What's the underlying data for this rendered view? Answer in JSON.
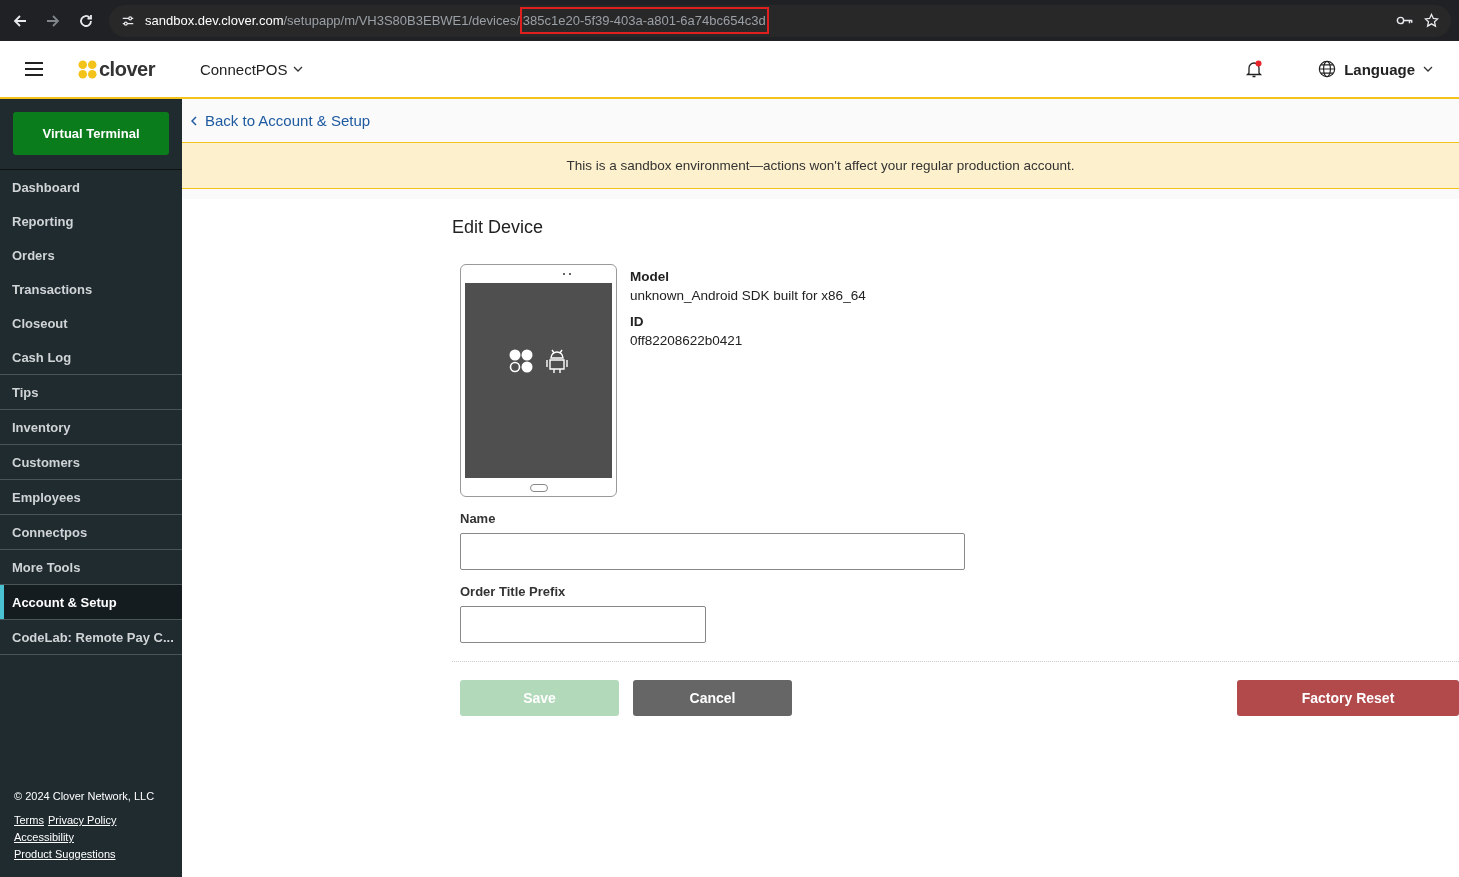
{
  "browser": {
    "url_host": "sandbox.dev.clover.com",
    "url_path": "/setupapp/m/VH3S80B3EBWE1/devices/",
    "url_highlight": "385c1e20-5f39-403a-a801-6a74bc654c3d",
    "forward_disabled": true
  },
  "header": {
    "logo": "clover",
    "app_menu": "ConnectPOS",
    "notification_dot": true,
    "language": "Language"
  },
  "sidebar": {
    "primary_button": "Virtual Terminal",
    "groups": [
      [
        {
          "label": "Dashboard",
          "selected": false
        },
        {
          "label": "Reporting",
          "selected": false
        },
        {
          "label": "Orders",
          "selected": false
        },
        {
          "label": "Transactions",
          "selected": false
        },
        {
          "label": "Closeout",
          "selected": false
        },
        {
          "label": "Cash Log",
          "selected": false
        }
      ],
      [
        {
          "label": "Tips",
          "selected": false
        }
      ],
      [
        {
          "label": "Inventory",
          "selected": false
        }
      ],
      [
        {
          "label": "Customers",
          "selected": false
        }
      ],
      [
        {
          "label": "Employees",
          "selected": false
        }
      ],
      [
        {
          "label": "Connectpos",
          "selected": false
        }
      ],
      [
        {
          "label": "More Tools",
          "selected": false
        }
      ],
      [
        {
          "label": "Account & Setup",
          "selected": true
        }
      ],
      [
        {
          "label": "CodeLab: Remote Pay C...",
          "selected": false
        }
      ]
    ],
    "copyright": "© 2024 Clover Network, LLC",
    "links": [
      [
        "Terms",
        "Privacy Policy"
      ],
      [
        "Accessibility"
      ],
      [
        "Product Suggestions"
      ]
    ]
  },
  "back_link": "Back to Account & Setup",
  "banner": "This is a sandbox environment—actions won't affect your regular production account.",
  "page": {
    "title": "Edit Device",
    "details": [
      {
        "label": "Model",
        "value": "unknown_Android SDK built for x86_64"
      },
      {
        "label": "ID",
        "value": "0ff82208622b0421"
      }
    ],
    "fields": [
      {
        "label": "Name"
      },
      {
        "label": "Order Title Prefix"
      }
    ],
    "buttons": [
      {
        "kind": "save",
        "label": "Save",
        "disabled": true
      },
      {
        "kind": "cancel",
        "label": "Cancel",
        "disabled": false
      },
      {
        "kind": "danger",
        "label": "Factory Reset",
        "disabled": false
      }
    ]
  }
}
